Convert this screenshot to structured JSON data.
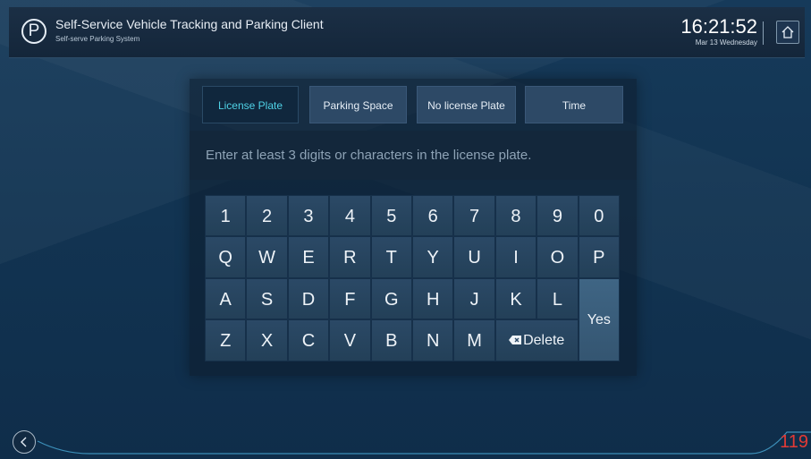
{
  "header": {
    "logo_text": "P",
    "title": "Self-Service Vehicle Tracking and Parking Client",
    "subtitle": "Self-serve Parking System",
    "time": "16:21:52",
    "date": "Mar 13  Wednesday",
    "home_icon": "home-icon"
  },
  "search": {
    "tabs": [
      {
        "label": "License Plate",
        "active": true
      },
      {
        "label": "Parking Space",
        "active": false
      },
      {
        "label": "No license Plate",
        "active": false
      },
      {
        "label": "Time",
        "active": false
      }
    ],
    "placeholder": "Enter at least 3 digits or characters in the license plate.",
    "value": ""
  },
  "keyboard": {
    "rows": [
      [
        "1",
        "2",
        "3",
        "4",
        "5",
        "6",
        "7",
        "8",
        "9",
        "0"
      ],
      [
        "Q",
        "W",
        "E",
        "R",
        "T",
        "Y",
        "U",
        "I",
        "O",
        "P"
      ],
      [
        "A",
        "S",
        "D",
        "F",
        "G",
        "H",
        "J",
        "K",
        "L"
      ],
      [
        "Z",
        "X",
        "C",
        "V",
        "B",
        "N",
        "M"
      ]
    ],
    "delete_label": "Delete",
    "yes_label": "Yes"
  },
  "footer": {
    "back_icon": "chevron-left-icon",
    "counter": "119"
  },
  "colors": {
    "accent": "#4fd2e6",
    "counter": "#e23a35",
    "key": "#2b4966",
    "yes_key": "#3f6584"
  }
}
